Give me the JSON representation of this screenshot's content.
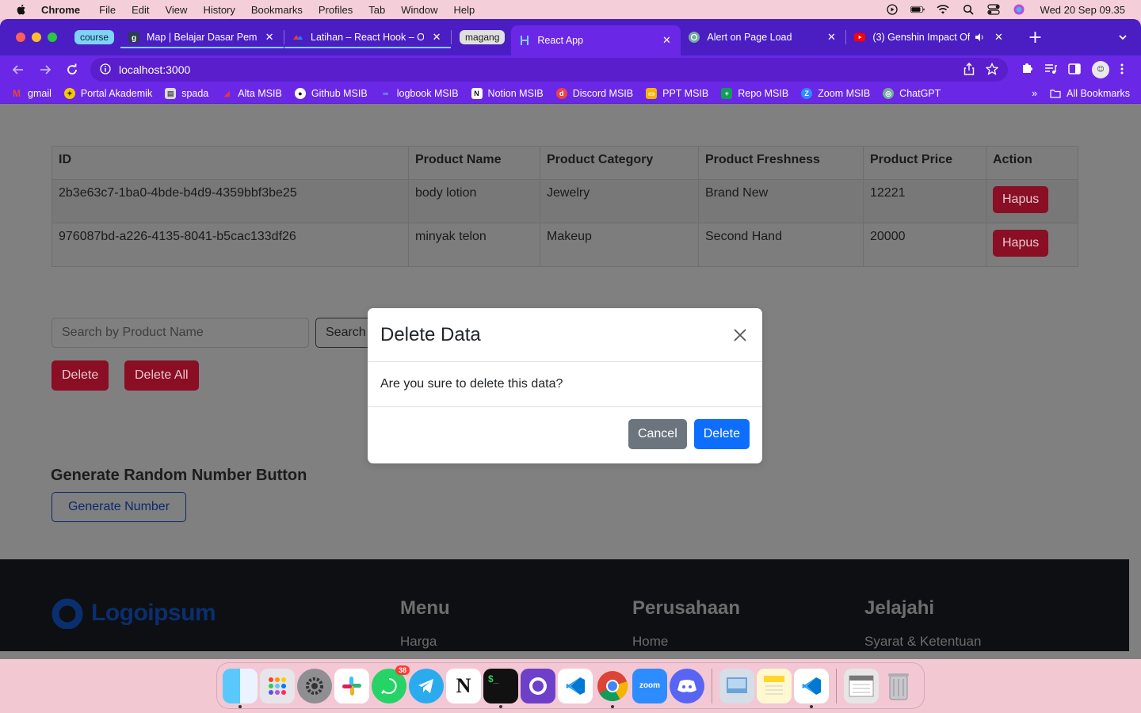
{
  "menubar": {
    "app_name": "Chrome",
    "items": [
      "File",
      "Edit",
      "View",
      "History",
      "Bookmarks",
      "Profiles",
      "Tab",
      "Window",
      "Help"
    ],
    "clock": "Wed 20 Sep  09.35"
  },
  "tabs": {
    "group_course": "course",
    "group_magang": "magang",
    "items": [
      {
        "title": "Map | Belajar Dasar Pemrog",
        "icon": "dicoding-icon"
      },
      {
        "title": "Latihan – React Hook – Oh",
        "icon": "alterra-icon"
      },
      {
        "title": "React App",
        "icon": "react-icon"
      },
      {
        "title": "Alert on Page Load",
        "icon": "chatgpt-icon"
      },
      {
        "title": "(3) Genshin Impact Of",
        "icon": "youtube-icon"
      }
    ]
  },
  "address_bar": {
    "url": "localhost:3000"
  },
  "bookmarks": {
    "items": [
      "gmail",
      "Portal Akademik",
      "spada",
      "Alta MSIB",
      "Github MSIB",
      "logbook MSIB",
      "Notion MSIB",
      "Discord MSIB",
      "PPT MSIB",
      "Repo MSIB",
      "Zoom MSIB",
      "ChatGPT"
    ],
    "all_label": "All Bookmarks",
    "overflow": "»"
  },
  "table": {
    "headers": [
      "ID",
      "Product Name",
      "Product Category",
      "Product Freshness",
      "Product Price",
      "Action"
    ],
    "rows": [
      {
        "id": "2b3e63c7-1ba0-4bde-b4d9-4359bbf3be25",
        "name": "body lotion",
        "category": "Jewelry",
        "freshness": "Brand New",
        "price": "12221",
        "action": "Hapus"
      },
      {
        "id": "976087bd-a226-4135-8041-b5cac133df26",
        "name": "minyak telon",
        "category": "Makeup",
        "freshness": "Second Hand",
        "price": "20000",
        "action": "Hapus"
      }
    ]
  },
  "search": {
    "placeholder": "Search by Product Name",
    "button": "Search"
  },
  "actions": {
    "delete": "Delete",
    "delete_all": "Delete All"
  },
  "generator": {
    "title": "Generate Random Number Button",
    "button": "Generate Number"
  },
  "footer": {
    "logo": "Logoipsum",
    "cols": [
      {
        "title": "Menu",
        "first_link": "Harga"
      },
      {
        "title": "Perusahaan",
        "first_link": "Home"
      },
      {
        "title": "Jelajahi",
        "first_link": "Syarat & Ketentuan"
      }
    ]
  },
  "modal": {
    "title": "Delete Data",
    "body": "Are you sure to delete this data?",
    "cancel": "Cancel",
    "confirm": "Delete"
  },
  "dock": {
    "whatsapp_badge": "38",
    "zoom_label": "zoom",
    "apps": [
      "finder",
      "launchpad",
      "system-settings",
      "slack",
      "whatsapp",
      "telegram",
      "notion",
      "terminal",
      "github-desktop",
      "vscode",
      "chrome",
      "zoom",
      "discord",
      "preview",
      "notes",
      "vscode-2",
      "file-xlsx",
      "trash"
    ]
  },
  "colors": {
    "tabstrip": "#4a1ec3",
    "toolbar": "#6a28e6",
    "danger": "#8a0e24",
    "primary": "#0d6efd",
    "secondary": "#6c757d"
  }
}
